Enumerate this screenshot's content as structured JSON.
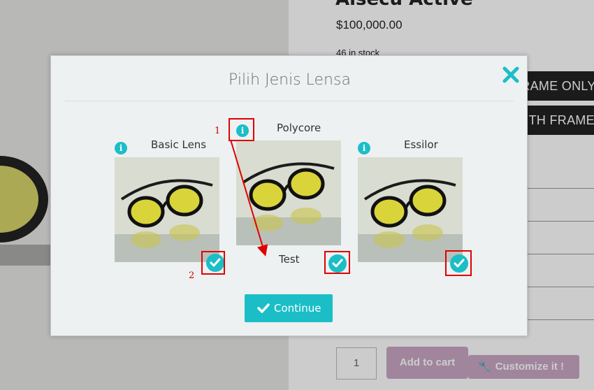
{
  "page": {
    "title_partial": "Aisecu Active",
    "price": "$100,000.00",
    "stock": "46 in stock",
    "option_buttons": [
      "FRAME ONLY",
      "WITH FRAME"
    ],
    "quantity": "1",
    "add_to_cart": "Add to cart",
    "customize": "Customize it !"
  },
  "modal": {
    "title": "Pilih Jenis Lensa",
    "lenses": [
      {
        "name": "Basic Lens"
      },
      {
        "name": "Polycore",
        "sub_label": "Test"
      },
      {
        "name": "Essilor"
      }
    ],
    "info_glyph": "i",
    "continue_label": "Continue"
  },
  "annotations": [
    "1",
    "2"
  ],
  "colors": {
    "accent": "#1bbec6",
    "annotation": "#e00000",
    "dark_button": "#222222",
    "cart_button": "#c9a7c5"
  },
  "icons": [
    "info-icon",
    "check-icon",
    "close-icon",
    "wrench-icon"
  ]
}
